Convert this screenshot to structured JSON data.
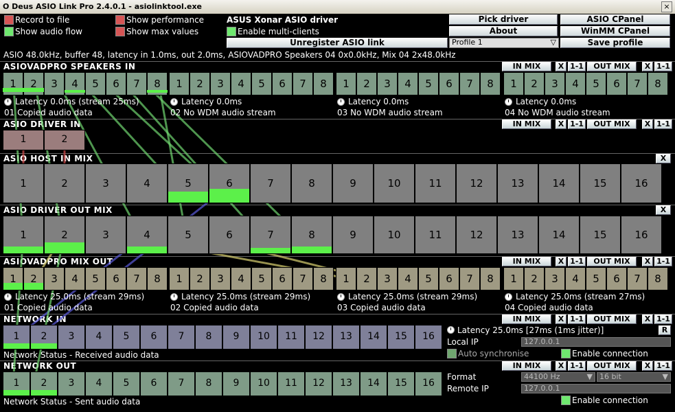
{
  "window": {
    "title": "O Deus ASIO Link Pro 2.4.0.1 - asiolinktool.exe",
    "close": "×"
  },
  "options": {
    "record_to_file": "Record to file",
    "show_audio_flow": "Show audio flow",
    "show_performance": "Show performance",
    "show_max_values": "Show max values",
    "driver_name": "ASUS Xonar ASIO driver",
    "enable_multi_clients": "Enable multi-clients"
  },
  "buttons": {
    "pick_driver": "Pick driver",
    "asio_cpanel": "ASIO CPanel",
    "about": "About",
    "winmm_cpanel": "WinMM CPanel",
    "unregister": "Unregister ASIO link",
    "profile": "Profile 1",
    "save_profile": "Save profile",
    "in_mix": "IN MIX",
    "out_mix": "OUT MIX",
    "x": "X",
    "one_one": "1-1"
  },
  "status_line": "ASIO 48.0kHz, buffer 48, latency in 1.0ms, out 2.0ms, ASIOVADPRO Speakers 04 0x0.0kHz, Mix 04 2x48.0kHz",
  "sections": {
    "speakers_in": {
      "title": "ASIOVADPRO SPEAKERS IN",
      "latencies": [
        "Latency 0.0ms (stream 25ms)",
        "Latency 0.0ms",
        "Latency 0.0ms",
        "Latency 0.0ms"
      ],
      "statuses": [
        "01 Copied audio data",
        "02 No WDM audio stream",
        "03 No WDM audio stream",
        "04 No WDM audio stream"
      ],
      "channels": [
        "1",
        "2",
        "3",
        "4",
        "5",
        "6",
        "7",
        "8"
      ]
    },
    "driver_in": {
      "title": "ASIO DRIVER IN",
      "channels": [
        "1",
        "2"
      ]
    },
    "host_in_mix": {
      "title": "ASIO HOST IN MIX",
      "channels": [
        "1",
        "2",
        "3",
        "4",
        "5",
        "6",
        "7",
        "8",
        "9",
        "10",
        "11",
        "12",
        "13",
        "14",
        "15",
        "16"
      ]
    },
    "driver_out_mix": {
      "title": "ASIO DRIVER OUT MIX",
      "channels": [
        "1",
        "2",
        "3",
        "4",
        "5",
        "6",
        "7",
        "8",
        "9",
        "10",
        "11",
        "12",
        "13",
        "14",
        "15",
        "16"
      ]
    },
    "mix_out": {
      "title": "ASIOVADPRO MIX OUT",
      "latencies": [
        "Latency 25.0ms (stream 29ms)",
        "Latency 25.0ms (stream 29ms)",
        "Latency 25.0ms (stream 29ms)",
        "Latency 25.0ms (stream 27ms)"
      ],
      "statuses": [
        "01 Copied audio data",
        "02 Copied audio data",
        "03 Copied audio data",
        "04 Copied audio data"
      ],
      "channels": [
        "1",
        "2",
        "3",
        "4",
        "5",
        "6",
        "7",
        "8"
      ]
    },
    "network_in": {
      "title": "NETWORK IN",
      "status": "Network Status - Received audio data",
      "latency": "Latency 25.0ms [27ms (1ms jitter)]",
      "r_button": "R",
      "local_ip_label": "Local IP",
      "local_ip": "127.0.0.1",
      "auto_sync": "Auto synchronise",
      "enable_connection": "Enable connection",
      "channels": [
        "1",
        "2",
        "3",
        "4",
        "5",
        "6",
        "7",
        "8",
        "9",
        "10",
        "11",
        "12",
        "13",
        "14",
        "15",
        "16"
      ]
    },
    "network_out": {
      "title": "NETWORK OUT",
      "status": "Network Status - Sent audio data",
      "format_label": "Format",
      "format_rate": "44100 Hz",
      "format_bits": "16 bit",
      "remote_ip_label": "Remote IP",
      "remote_ip": "127.0.0.1",
      "enable_connection": "Enable connection",
      "channels": [
        "1",
        "2",
        "3",
        "4",
        "5",
        "6",
        "7",
        "8",
        "9",
        "10",
        "11",
        "12",
        "13",
        "14",
        "15",
        "16"
      ]
    }
  },
  "colors": {
    "accent_green": "#5cf04a",
    "checkbox_red": "#d65555",
    "checkbox_green": "#6fe86f"
  }
}
